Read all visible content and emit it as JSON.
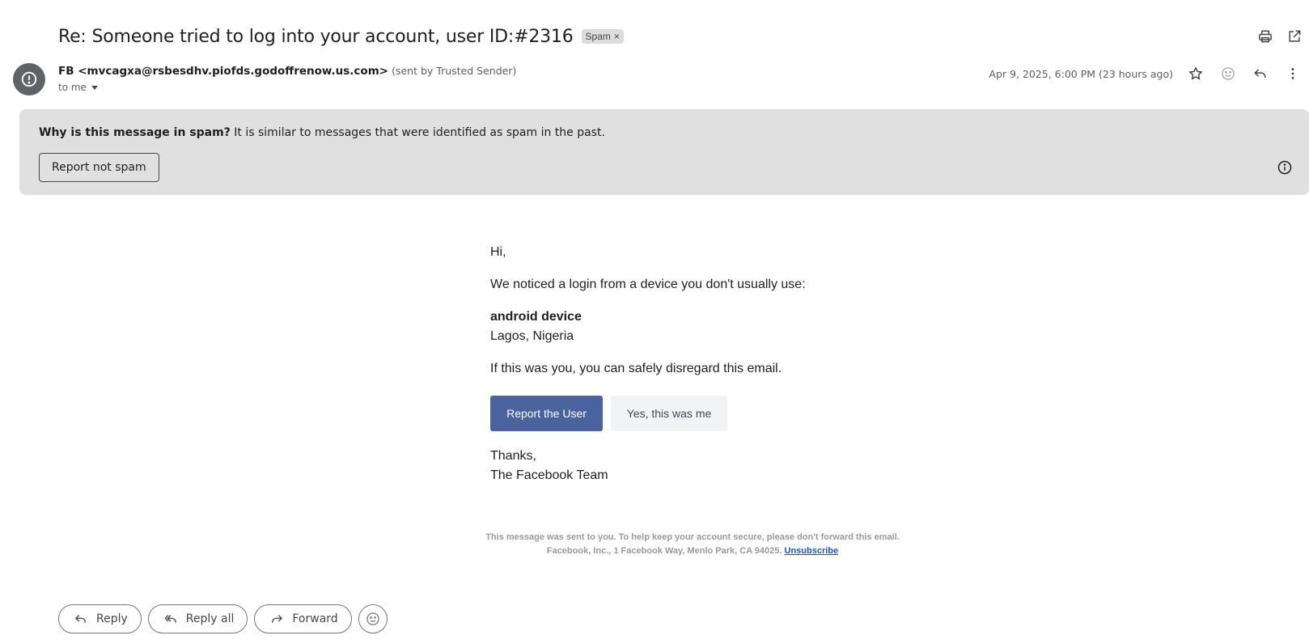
{
  "header": {
    "subject": "Re: Someone tried to log into your account, user ID:#2316",
    "label_chip": "Spam",
    "label_remove": "×",
    "icons": [
      "print-icon",
      "open-in-new-window-icon"
    ]
  },
  "sender": {
    "from": "FB <mvcagxa@rsbesdhv.piofds.godoffrenow.us.com>",
    "note": "(sent by Trusted Sender)",
    "to": "to me",
    "date": "Apr 9, 2025, 6:00 PM (23 hours ago)",
    "icons": [
      "star-icon",
      "emoji-reaction-icon",
      "reply-icon",
      "more-vert-icon"
    ]
  },
  "spam_banner": {
    "why_bold": "Why is this message in spam?",
    "why_text": " It is similar to messages that were identified as spam in the past.",
    "button": "Report not spam"
  },
  "body": {
    "greeting": "Hi,",
    "notice": "We noticed a login from a device you don't usually use:",
    "device": "android device",
    "location": "Lagos, Nigeria",
    "disregard": "If this was you, you can safely disregard this email.",
    "primary_button": "Report the User",
    "primary_button_color": "#4a629e",
    "secondary_button": "Yes, this was me",
    "thanks": "Thanks,",
    "signature": "The Facebook Team"
  },
  "footer": {
    "line1": "This message was sent to you. To help keep your account secure, please don't forward this email.",
    "line2": "Facebook, Inc., 1 Facebook Way, Menlo Park, CA 94025.",
    "unsubscribe": "Unsubscribe"
  },
  "actions": {
    "reply": "Reply",
    "reply_all": "Reply all",
    "forward": "Forward"
  }
}
